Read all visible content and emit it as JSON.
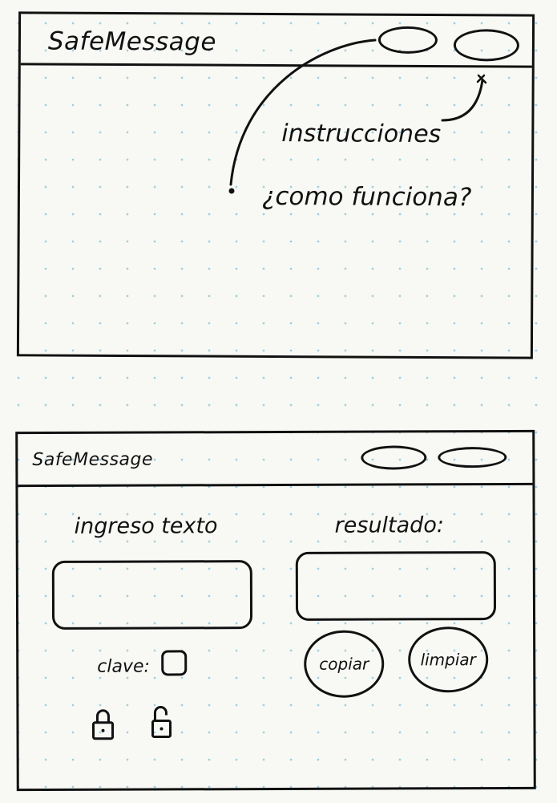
{
  "screen_main": {
    "title": "SafeMessage",
    "buttons": [
      {
        "name": "header-oval-button-1"
      },
      {
        "name": "header-oval-button-2"
      }
    ],
    "annotations": {
      "instructions": "instrucciones",
      "how_it_works": "¿como funciona?"
    }
  },
  "screen_tool": {
    "title": "SafeMessage",
    "input_label": "ingreso texto",
    "result_label": "resultado:",
    "key_label": "clave:",
    "copy_button": "copiar",
    "clear_button": "limpiar",
    "icons": [
      "lock-closed-icon",
      "lock-open-icon"
    ]
  }
}
